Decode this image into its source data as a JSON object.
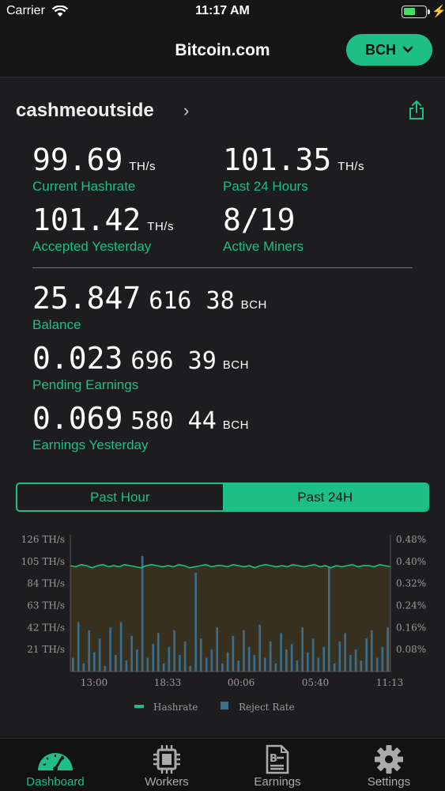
{
  "status_bar": {
    "carrier": "Carrier",
    "time": "11:17 AM"
  },
  "nav": {
    "title": "Bitcoin.com",
    "coin_label": "BCH"
  },
  "account": {
    "name": "cashmeoutside"
  },
  "stats": {
    "current_hashrate": {
      "value": "99.69",
      "unit": "TH/s",
      "label": "Current Hashrate"
    },
    "past_24": {
      "value": "101.35",
      "unit": "TH/s",
      "label": "Past 24 Hours"
    },
    "accepted_yesterday": {
      "value": "101.42",
      "unit": "TH/s",
      "label": "Accepted Yesterday"
    },
    "active_miners": {
      "value": "8/19",
      "label": "Active Miners"
    }
  },
  "balances": {
    "balance": {
      "main": "25.847",
      "small": "616 38",
      "unit": "BCH",
      "label": "Balance"
    },
    "pending": {
      "main": "0.023",
      "small": "696 39",
      "unit": "BCH",
      "label": "Pending Earnings"
    },
    "yesterday": {
      "main": "0.069",
      "small": "580 44",
      "unit": "BCH",
      "label": "Earnings Yesterday"
    }
  },
  "segments": {
    "past_hour": "Past Hour",
    "past_24h": "Past 24H",
    "selected": "Past 24H"
  },
  "colors": {
    "accent": "#1dbf86",
    "reject": "#3a6d8f",
    "background": "#1d1d1f"
  },
  "chart_data": {
    "type": "line",
    "x_ticks": [
      "13:00",
      "18:33",
      "00:06",
      "05:40",
      "11:13"
    ],
    "y_left_ticks": [
      "126 TH/s",
      "105 TH/s",
      "84 TH/s",
      "63 TH/s",
      "42 TH/s",
      "21 TH/s"
    ],
    "y_right_ticks": [
      "0.48%",
      "0.40%",
      "0.32%",
      "0.24%",
      "0.16%",
      "0.08%"
    ],
    "ylim_left": [
      0,
      126
    ],
    "ylim_right": [
      0,
      0.48
    ],
    "legend": [
      "Hashrate",
      "Reject Rate"
    ],
    "legend_position": "bottom",
    "series": [
      {
        "name": "Hashrate",
        "values": [
          101,
          100,
          102,
          101,
          99,
          101,
          102,
          100,
          101,
          100,
          102,
          101,
          100,
          99,
          101,
          102,
          101,
          100,
          101,
          100,
          102,
          101,
          99,
          100,
          101,
          102,
          100,
          101,
          101,
          100,
          102,
          101,
          100,
          101,
          99,
          101,
          102,
          101,
          100,
          101,
          100,
          102,
          101,
          100,
          101,
          102,
          100,
          101,
          99,
          101,
          100,
          101,
          102,
          100,
          101,
          101,
          100,
          102,
          101,
          100
        ]
      },
      {
        "name": "Reject Rate",
        "values": [
          0.05,
          0.18,
          0.03,
          0.15,
          0.07,
          0.12,
          0.02,
          0.16,
          0.06,
          0.18,
          0.04,
          0.13,
          0.08,
          0.42,
          0.05,
          0.1,
          0.14,
          0.03,
          0.09,
          0.15,
          0.06,
          0.11,
          0.02,
          0.36,
          0.12,
          0.05,
          0.08,
          0.16,
          0.03,
          0.07,
          0.13,
          0.04,
          0.15,
          0.09,
          0.06,
          0.17,
          0.05,
          0.11,
          0.03,
          0.14,
          0.08,
          0.1,
          0.04,
          0.16,
          0.07,
          0.12,
          0.05,
          0.09,
          0.38,
          0.03,
          0.11,
          0.14,
          0.06,
          0.08,
          0.04,
          0.12,
          0.15,
          0.05,
          0.09,
          0.16
        ]
      }
    ]
  },
  "tabs": [
    {
      "label": "Dashboard",
      "icon": "gauge-icon"
    },
    {
      "label": "Workers",
      "icon": "chip-icon"
    },
    {
      "label": "Earnings",
      "icon": "invoice-icon"
    },
    {
      "label": "Settings",
      "icon": "gear-icon"
    }
  ]
}
